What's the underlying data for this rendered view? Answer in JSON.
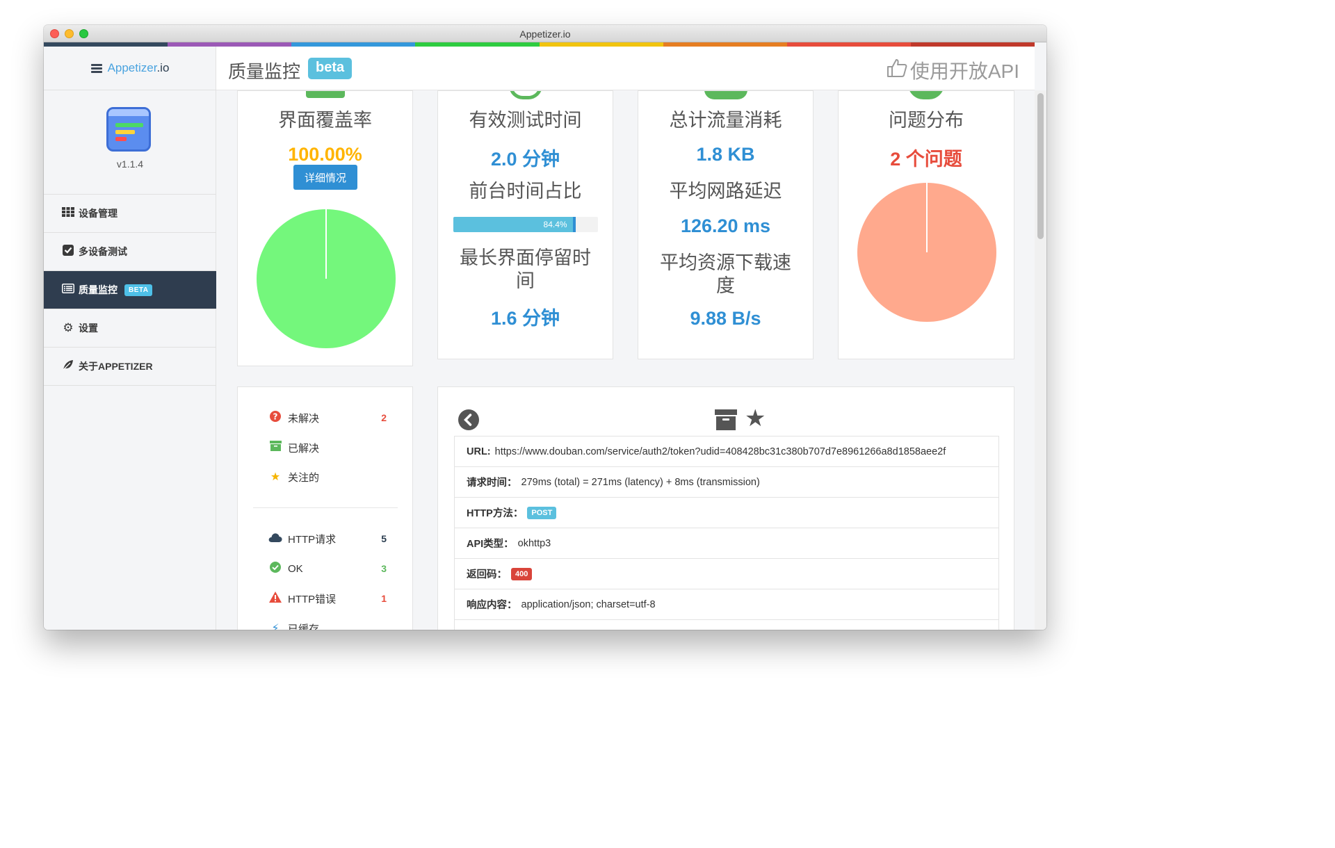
{
  "window": {
    "title": "Appetizer.io"
  },
  "colors": {
    "stripe": [
      "#34495e",
      "#9b59b6",
      "#3498db",
      "#2ecc40",
      "#f1c40f",
      "#e67e22",
      "#e74c3c",
      "#c0392b"
    ],
    "accent": "#2f8fd4",
    "sidebar_active": "#2f3d4f",
    "pie_green": "#74f77c",
    "pie_salmon": "#ffa98d"
  },
  "sidebar": {
    "brand": "Appetizer",
    "brand_suffix": ".io",
    "version": "v1.1.4",
    "items": [
      {
        "label": "设备管理",
        "icon": "grid-icon",
        "active": false
      },
      {
        "label": "多设备测试",
        "icon": "checkbox-icon",
        "active": false
      },
      {
        "label": "质量监控",
        "icon": "list-icon",
        "active": true,
        "badge": "BETA"
      },
      {
        "label": "设置",
        "icon": "gear-icon",
        "active": false
      },
      {
        "label": "关于APPETIZER",
        "icon": "leaf-icon",
        "active": false
      }
    ]
  },
  "header": {
    "title": "质量监控",
    "beta": "beta",
    "api_label": "使用开放API"
  },
  "metrics": {
    "coverage": {
      "label": "界面覆盖率",
      "value": "100.00%",
      "button": "详细情况",
      "percent": 100
    },
    "test_time": {
      "label": "有效测试时间",
      "value": "2.0 分钟",
      "fg_label": "前台时间占比",
      "fg_percent": 84.4,
      "fg_text": "84.4%",
      "max_label": "最长界面停留时间",
      "max_value": "1.6 分钟"
    },
    "traffic": {
      "label": "总计流量消耗",
      "value": "1.8 KB",
      "latency_label": "平均网路延迟",
      "latency_value": "126.20 ms",
      "speed_label": "平均资源下载速度",
      "speed_value": "9.88 B/s"
    },
    "issues": {
      "label": "问题分布",
      "value": "2 个问题"
    }
  },
  "filters": {
    "status": [
      {
        "label": "未解决",
        "count": "2",
        "icon": "question-circle-icon"
      },
      {
        "label": "已解决",
        "count": "",
        "icon": "archive-icon"
      },
      {
        "label": "关注的",
        "count": "",
        "icon": "star-icon"
      }
    ],
    "types": [
      {
        "label": "HTTP请求",
        "count": "5",
        "icon": "cloud-icon"
      },
      {
        "label": "OK",
        "count": "3",
        "icon": "check-circle-icon"
      },
      {
        "label": "HTTP错误",
        "count": "1",
        "icon": "warning-icon"
      },
      {
        "label": "已缓存",
        "count": "",
        "icon": "bolt-icon"
      }
    ]
  },
  "detail": {
    "url_label": "URL:",
    "url": "https://www.douban.com/service/auth2/token?udid=408428bc31c380b707d7e8961266a8d1858aee2f",
    "time_label": "请求时间：",
    "time": "279ms (total) = 271ms (latency) + 8ms (transmission)",
    "method_label": "HTTP方法：",
    "method": "POST",
    "api_label": "API类型：",
    "api": "okhttp3",
    "code_label": "返回码：",
    "code": "400",
    "content_label": "响应内容：",
    "content": "application/json; charset=utf-8"
  }
}
